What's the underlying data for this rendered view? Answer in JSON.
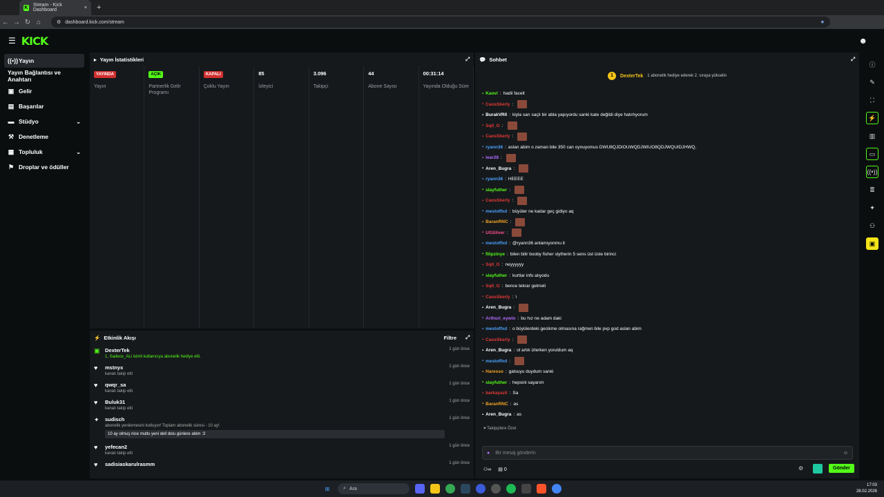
{
  "browser": {
    "tab_title": "Stream - Kick Dashboard",
    "url": "dashboard.kick.com/stream"
  },
  "brand": {
    "logo": "KICK",
    "accent": "#53fc18"
  },
  "sidebar": {
    "items": [
      {
        "label": "Yayın",
        "icon": "broadcast-icon"
      },
      {
        "label": "Yayın Bağlantısı ve Anahtarı",
        "icon": ""
      },
      {
        "label": "Gelir",
        "icon": "revenue-icon"
      },
      {
        "label": "Başarılar",
        "icon": "achievements-icon"
      },
      {
        "label": "Stüdyo",
        "icon": "studio-icon"
      },
      {
        "label": "Denetleme",
        "icon": "moderation-icon"
      },
      {
        "label": "Topluluk",
        "icon": "community-icon"
      },
      {
        "label": "Droplar ve ödüller",
        "icon": "drops-icon"
      }
    ]
  },
  "stats": {
    "title": "Yayın İstatistikleri",
    "cols": [
      {
        "value": "YAYINDA",
        "label": "Yayın",
        "badge": "red"
      },
      {
        "value": "AÇIK",
        "label": "Partnerlik Gelir Programı",
        "badge": "green"
      },
      {
        "value": "KAPALI",
        "label": "Çoklu Yayın",
        "badge": "red"
      },
      {
        "value": "85",
        "label": "İzleyici"
      },
      {
        "value": "3.096",
        "label": "Takipçi"
      },
      {
        "value": "44",
        "label": "Abone Sayısı"
      },
      {
        "value": "00:31:14",
        "label": "Yayında Olduğu Süre"
      }
    ]
  },
  "activity": {
    "title": "Etkinlik Akışı",
    "filter": "Filtre",
    "items": [
      {
        "name": "DexterTek",
        "sub": "1, Sadece_ALi isimli kullanıcıya abonelik hediye etti.",
        "time": "1 gün önce",
        "icon": "gift-icon",
        "green": true
      },
      {
        "name": "mstnyx",
        "sub": "kanalı takip etti",
        "time": "1 gün önce",
        "icon": "heart-icon"
      },
      {
        "name": "qwqr_sa",
        "sub": "kanalı takip etti",
        "time": "1 gün önce",
        "icon": "heart-icon"
      },
      {
        "name": "Buluk31",
        "sub": "kanalı takip etti",
        "time": "1 gün önce",
        "icon": "heart-icon"
      },
      {
        "name": "sudisch",
        "sub": "abonelik yenilemesini kutluyor! Toplam abonelik süresi - 10 ay!",
        "time": "1 gün önce",
        "icon": "star-icon",
        "note": "10 ay olmuş nice mutlu yeni dell dolu günlere abim :3"
      },
      {
        "name": "yefecan2",
        "sub": "kanalı takip etti",
        "time": "1 gün önce",
        "icon": "heart-icon"
      },
      {
        "name": "sadisiaskarulrasmm",
        "sub": "",
        "time": "1 gün önce",
        "icon": "heart-icon"
      }
    ]
  },
  "chat": {
    "title": "Sohbet",
    "pinned_user": "DexterTek",
    "pinned_count": "1",
    "pinned_text": "1 abonelik hediye ederek 2. sıraya yükselin",
    "followers_only": "Takipçilere Özel",
    "placeholder": "Bir mesaj gönderin",
    "send": "Gönder",
    "points": "0",
    "messages": [
      {
        "user": "Kaovi",
        "color": "#53fc18",
        "text": "hadil facelt"
      },
      {
        "user": "CaosSkerly",
        "color": "#e53935",
        "text": "",
        "emote": true
      },
      {
        "user": "BurakVRll",
        "color": "#ffffff",
        "text": "kiyla sarı saçlı bir abla yapıyordu sanki kate değildi diye hatırlıyorum"
      },
      {
        "user": "Sqll_G",
        "color": "#e53935",
        "text": "",
        "emote": true
      },
      {
        "user": "CaosSkerly",
        "color": "#e53935",
        "text": "",
        "emote": true
      },
      {
        "user": "ryann36",
        "color": "#4aa3ff",
        "text": "aslan abim o zaman bile 350 can oynuyomus DWU8QJDIOUWQDJWIUO8QDJWQUIDJHWQ,"
      },
      {
        "user": "lear28",
        "color": "#b36bff",
        "text": "",
        "emote": true
      },
      {
        "user": "Aren_Bugra",
        "color": "#ffffff",
        "text": "",
        "emote": true
      },
      {
        "user": "ryann36",
        "color": "#4aa3ff",
        "text": "HEEEE"
      },
      {
        "user": "slayfuther",
        "color": "#53fc18",
        "text": "",
        "emote": true
      },
      {
        "user": "CaosSkerly",
        "color": "#e53935",
        "text": "",
        "emote": true
      },
      {
        "user": "mestoffxd",
        "color": "#4aa3ff",
        "text": "büyüler ne kadar geç gidiyo aq"
      },
      {
        "user": "BaranRNC",
        "color": "#f5a623",
        "text": "",
        "emote": true
      },
      {
        "user": "UGSilver",
        "color": "#ff4d8d",
        "text": "",
        "emote": true
      },
      {
        "user": "mestoffxd",
        "color": "#4aa3ff",
        "text": "@ryann36 anlamıyonmu it"
      },
      {
        "user": "filipzinye",
        "color": "#53fc18",
        "text": "bilen bilir booby fisher slytherin 5 sens üst üste birinci"
      },
      {
        "user": "Sqll_G",
        "color": "#e53935",
        "text": "neyyyyyy"
      },
      {
        "user": "slayfuther",
        "color": "#53fc18",
        "text": "kurtlar info alıyodu"
      },
      {
        "user": "Sqll_G",
        "color": "#e53935",
        "text": "bence tekrar gelmeli"
      },
      {
        "user": "CaosSkerly",
        "color": "#e53935",
        "text": "\\"
      },
      {
        "user": "Aren_Bugra",
        "color": "#ffffff",
        "text": "",
        "emote": true
      },
      {
        "user": "Arthurl_eywin",
        "color": "#b36bff",
        "text": "bu hız ne adam daki"
      },
      {
        "user": "mestoffxd",
        "color": "#4aa3ff",
        "text": "o büyülerdeki gecikme olmasına rağmen bile pvp god aslan abim"
      },
      {
        "user": "CaosSkerly",
        "color": "#e53935",
        "text": "",
        "emote": true
      },
      {
        "user": "Aren_Bugra",
        "color": "#ffffff",
        "text": "ol artık izlerken yoruldum aq"
      },
      {
        "user": "mestoffxd",
        "color": "#4aa3ff",
        "text": "",
        "emote": true
      },
      {
        "user": "Haresso",
        "color": "#f5a623",
        "text": "gatsuyu duydum sanki"
      },
      {
        "user": "slayfuther",
        "color": "#53fc18",
        "text": "hepsini sayarım"
      },
      {
        "user": "barkayazil",
        "color": "#e53935",
        "text": "Sa"
      },
      {
        "user": "BaranRNC",
        "color": "#f5a623",
        "text": "as"
      },
      {
        "user": "Aren_Bugra",
        "color": "#ffffff",
        "text": "as"
      }
    ]
  },
  "taskbar": {
    "search": "Ara",
    "time": "17:03",
    "date": "28.02.2026"
  }
}
